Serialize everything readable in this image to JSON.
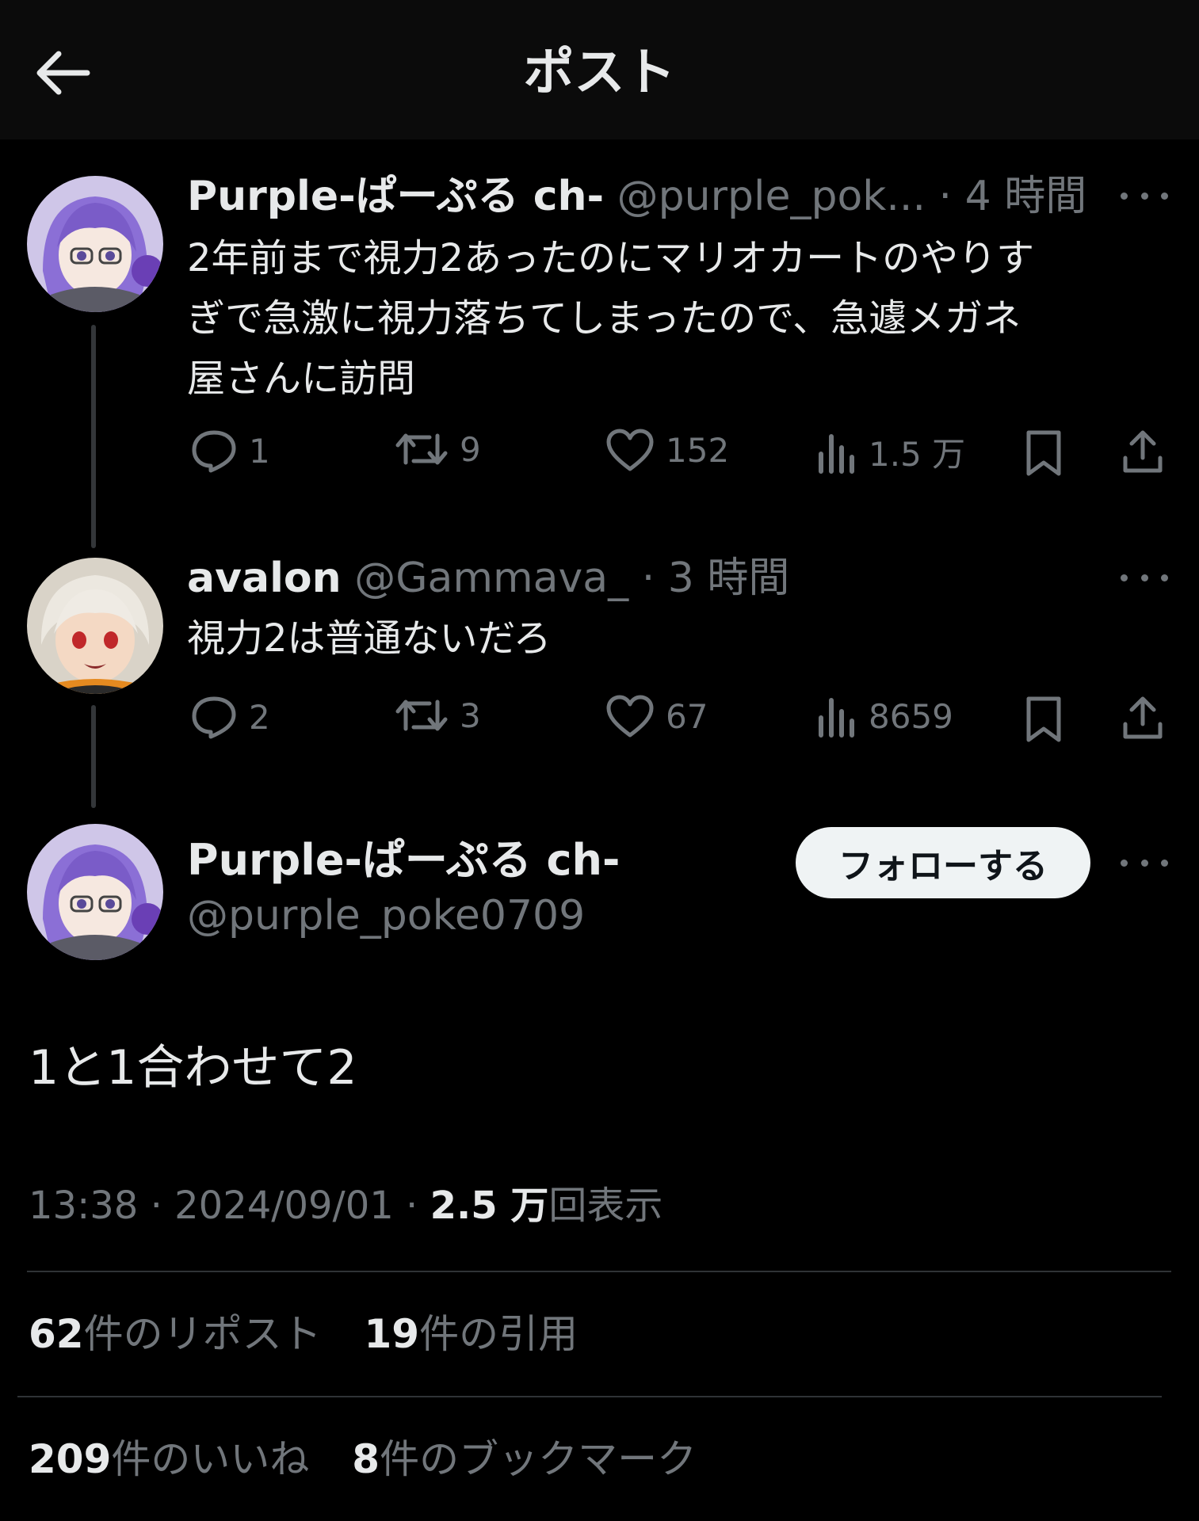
{
  "header": {
    "title": "ポスト"
  },
  "tweets": [
    {
      "name": "Purple-ぱーぷる ch-",
      "handle": "@purple_pok...",
      "dot": "·",
      "time": "4 時間",
      "text_lines": [
        "2年前まで視力2あったのにマリオカートのやりす",
        "ぎで急激に視力落ちてしまったので、急遽メガネ",
        "屋さんに訪問"
      ],
      "replies": "1",
      "reposts": "9",
      "likes": "152",
      "views": "1.5 万"
    },
    {
      "name": "avalon",
      "handle": "@Gammava_",
      "dot": "·",
      "time": "3 時間",
      "text_lines": [
        "視力2は普通ないだろ"
      ],
      "replies": "2",
      "reposts": "3",
      "likes": "67",
      "views": "8659"
    }
  ],
  "main": {
    "name": "Purple-ぱーぷる ch-",
    "handle": "@purple_poke0709",
    "follow_label": "フォローする",
    "text": "1と1合わせて2",
    "time": "13:38",
    "sep": "·",
    "date": "2024/09/01",
    "views_count": "2.5 万",
    "views_label": "回表示"
  },
  "stats": {
    "reposts_count": "62",
    "reposts_label": "件のリポスト",
    "quotes_count": "19",
    "quotes_label": "件の引用",
    "likes_count": "209",
    "likes_label": "件のいいね",
    "bookmarks_count": "8",
    "bookmarks_label": "件のブックマーク"
  },
  "colors": {
    "background": "#000000",
    "header_bg": "#0b0b0b",
    "text": "#e7e9ea",
    "muted": "#71767b",
    "avatar_purple": "#8b6fd6",
    "avatar_white": "#e8e4dc"
  }
}
